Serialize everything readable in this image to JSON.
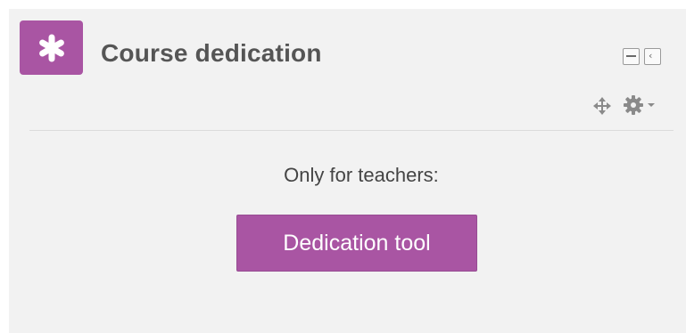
{
  "block": {
    "title": "Course dedication",
    "icon": "asterisk-icon",
    "controls": {
      "hide_icon": "minus-box-icon",
      "dock_icon": "dock-left-icon",
      "move_icon": "move-icon",
      "actions_icon": "gear-icon",
      "actions_caret_icon": "caret-down-icon"
    },
    "content": {
      "teachers_label": "Only for teachers:",
      "button_label": "Dedication tool"
    }
  },
  "colors": {
    "accent": "#a955a3",
    "block_background": "#f2f2f2",
    "title_text": "#555555",
    "body_text": "#444444",
    "button_text": "#ffffff"
  }
}
